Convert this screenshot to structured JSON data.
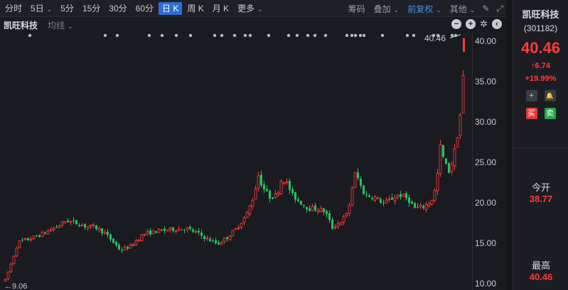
{
  "toolbar": {
    "periods": [
      "分时",
      "5日",
      "5分",
      "15分",
      "30分",
      "60分",
      "日 K",
      "周 K",
      "月 K",
      "更多"
    ],
    "active_period": "日 K",
    "chip": "筹码",
    "overlay": "叠加",
    "adjust": "前复权",
    "other": "其他"
  },
  "bar2": {
    "stock_name": "凯旺科技",
    "ma_label": "均线",
    "minus_icon": "−",
    "plus_icon": "+",
    "gear_icon": "✲",
    "collapse_icon": "‹"
  },
  "chart_data": {
    "type": "candlestick",
    "y_ticks": [
      "40.00",
      "35.00",
      "30.00",
      "25.00",
      "20.00",
      "15.00",
      "10.00"
    ],
    "ylim": [
      9.6,
      41.4
    ],
    "last_price_label": "40.46",
    "low_label": "9.06",
    "colors": {
      "up": "#ff3b3b",
      "down": "#22c55e"
    }
  },
  "panel": {
    "name": "凯旺科技",
    "code": "(301182)",
    "price": "40.46",
    "change": "6.74",
    "change_arrow": "↑",
    "pct": "+19.99%",
    "plus_icon": "+",
    "bell_icon": "🔔",
    "buy": "买",
    "sell": "卖",
    "open_label": "今开",
    "open_value": "38.77",
    "high_label": "最高",
    "high_value": "40.46"
  }
}
